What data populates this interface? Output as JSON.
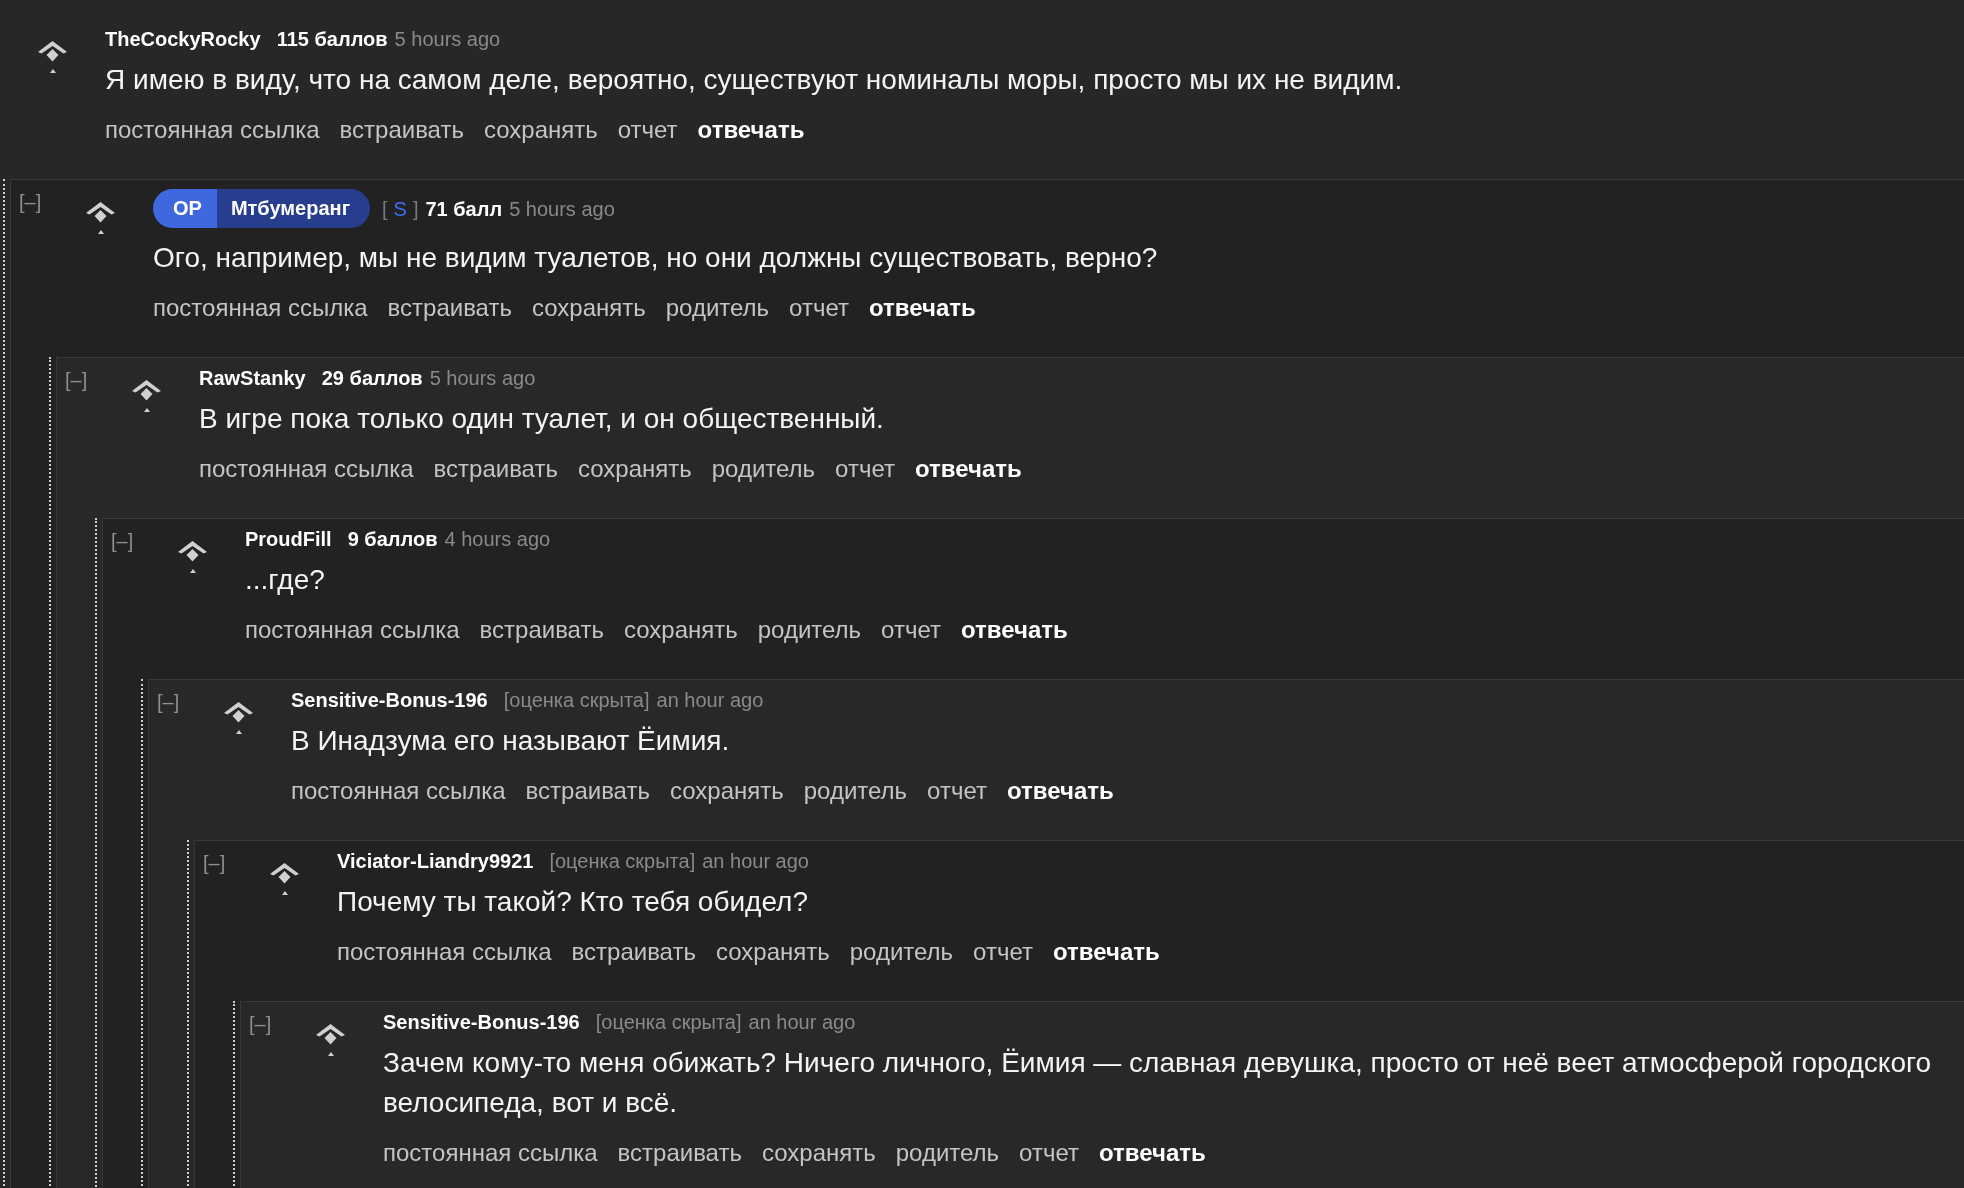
{
  "comments": [
    {
      "author": "TheCockyRocky",
      "score": "115 баллов",
      "score_hidden": false,
      "time": "5 hours ago",
      "body": "Я имею в виду, что на самом деле, вероятно, существуют номиналы моры, просто мы их не видим.",
      "actions": [
        {
          "label": "постоянная ссылка",
          "kind": "link"
        },
        {
          "label": "встраивать",
          "kind": "link"
        },
        {
          "label": "сохранять",
          "kind": "link"
        },
        {
          "label": "отчет",
          "kind": "link"
        },
        {
          "label": "отвечать",
          "kind": "reply"
        }
      ],
      "children": [
        {
          "collapse": "[–]",
          "op_label": "OP",
          "author": "Мтбумеранг",
          "submitter_tag": {
            "open": "[",
            "letter": "S",
            "close": "]"
          },
          "score": "71 балл",
          "score_hidden": false,
          "time": "5 hours ago",
          "body": "Ого, например, мы не видим туалетов, но они должны существовать, верно?",
          "actions": [
            {
              "label": "постоянная ссылка",
              "kind": "link"
            },
            {
              "label": "встраивать",
              "kind": "link"
            },
            {
              "label": "сохранять",
              "kind": "link"
            },
            {
              "label": "родитель",
              "kind": "link"
            },
            {
              "label": "отчет",
              "kind": "link"
            },
            {
              "label": "отвечать",
              "kind": "reply"
            }
          ],
          "children": [
            {
              "collapse": "[–]",
              "author": "RawStanky",
              "score": "29 баллов",
              "score_hidden": false,
              "time": "5 hours ago",
              "body": "В игре пока только один туалет, и он общественный.",
              "actions": [
                {
                  "label": "постоянная ссылка",
                  "kind": "link"
                },
                {
                  "label": "встраивать",
                  "kind": "link"
                },
                {
                  "label": "сохранять",
                  "kind": "link"
                },
                {
                  "label": "родитель",
                  "kind": "link"
                },
                {
                  "label": "отчет",
                  "kind": "link"
                },
                {
                  "label": "отвечать",
                  "kind": "reply"
                }
              ],
              "children": [
                {
                  "collapse": "[–]",
                  "author": "ProudFill",
                  "score": "9 баллов",
                  "score_hidden": false,
                  "time": "4 hours ago",
                  "body": "...где?",
                  "actions": [
                    {
                      "label": "постоянная ссылка",
                      "kind": "link"
                    },
                    {
                      "label": "встраивать",
                      "kind": "link"
                    },
                    {
                      "label": "сохранять",
                      "kind": "link"
                    },
                    {
                      "label": "родитель",
                      "kind": "link"
                    },
                    {
                      "label": "отчет",
                      "kind": "link"
                    },
                    {
                      "label": "отвечать",
                      "kind": "reply"
                    }
                  ],
                  "children": [
                    {
                      "collapse": "[–]",
                      "author": "Sensitive-Bonus-196",
                      "score": "[оценка скрыта]",
                      "score_hidden": true,
                      "time": "an hour ago",
                      "body": "В Инадзума его называют Ёимия.",
                      "actions": [
                        {
                          "label": "постоянная ссылка",
                          "kind": "link"
                        },
                        {
                          "label": "встраивать",
                          "kind": "link"
                        },
                        {
                          "label": "сохранять",
                          "kind": "link"
                        },
                        {
                          "label": "родитель",
                          "kind": "link"
                        },
                        {
                          "label": "отчет",
                          "kind": "link"
                        },
                        {
                          "label": "отвечать",
                          "kind": "reply"
                        }
                      ],
                      "children": [
                        {
                          "collapse": "[–]",
                          "author": "Viciator-Liandry9921",
                          "score": "[оценка скрыта]",
                          "score_hidden": true,
                          "time": "an hour ago",
                          "body": "Почему ты такой? Кто тебя обидел?",
                          "actions": [
                            {
                              "label": "постоянная ссылка",
                              "kind": "link"
                            },
                            {
                              "label": "встраивать",
                              "kind": "link"
                            },
                            {
                              "label": "сохранять",
                              "kind": "link"
                            },
                            {
                              "label": "родитель",
                              "kind": "link"
                            },
                            {
                              "label": "отчет",
                              "kind": "link"
                            },
                            {
                              "label": "отвечать",
                              "kind": "reply"
                            }
                          ],
                          "children": [
                            {
                              "collapse": "[–]",
                              "author": "Sensitive-Bonus-196",
                              "score": "[оценка скрыта]",
                              "score_hidden": true,
                              "time": "an hour ago",
                              "body": "Зачем кому-то меня обижать? Ничего личного, Ёимия — славная девушка, просто от неё веет атмосферой городского велосипеда, вот и всё.",
                              "actions": [
                                {
                                  "label": "постоянная ссылка",
                                  "kind": "link"
                                },
                                {
                                  "label": "встраивать",
                                  "kind": "link"
                                },
                                {
                                  "label": "сохранять",
                                  "kind": "link"
                                },
                                {
                                  "label": "родитель",
                                  "kind": "link"
                                },
                                {
                                  "label": "отчет",
                                  "kind": "link"
                                },
                                {
                                  "label": "отвечать",
                                  "kind": "reply"
                                }
                              ]
                            }
                          ]
                        }
                      ]
                    }
                  ]
                }
              ]
            }
          ]
        }
      ]
    }
  ]
}
